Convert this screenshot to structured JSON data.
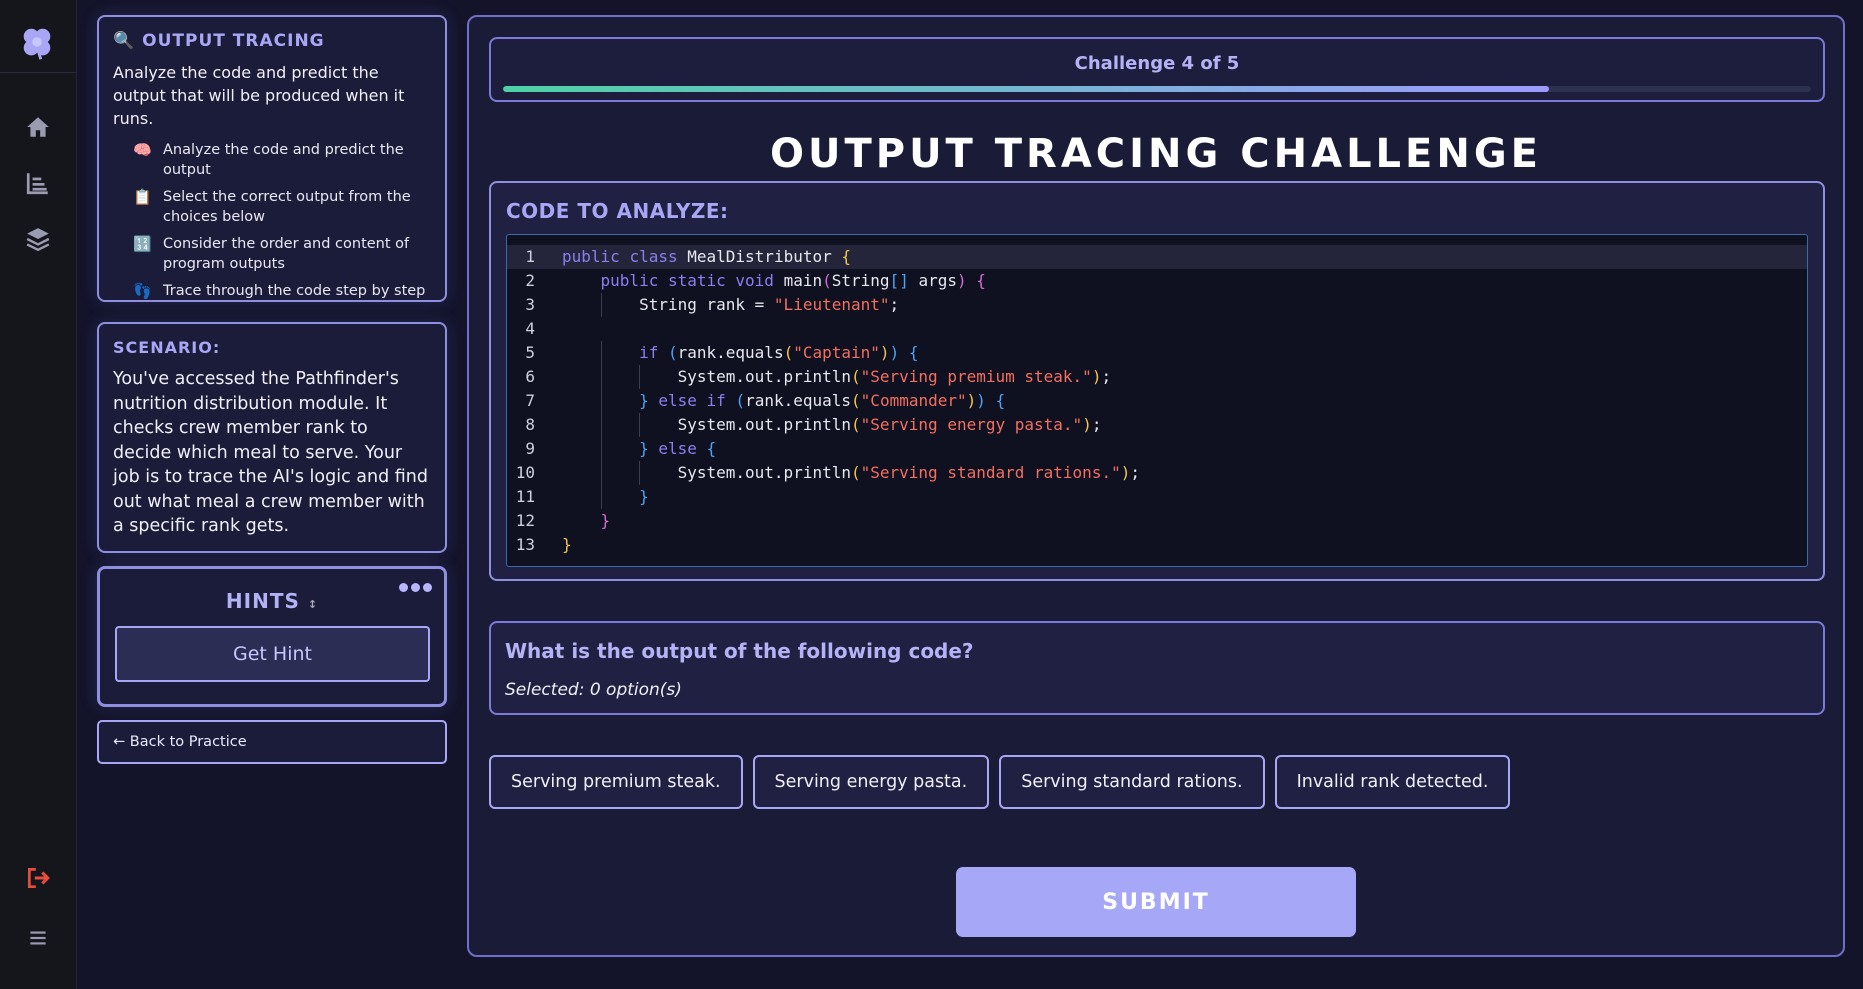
{
  "colors": {
    "accent": "#a9a7f5",
    "progress_start": "#4fd1a5",
    "progress_end": "#9d9bff",
    "logout": "#e74c3c",
    "submit": "#a7a7f8"
  },
  "rail": {
    "icons": [
      "clover-logo-icon",
      "home-icon",
      "chart-icon",
      "layers-icon",
      "logout-icon",
      "menu-icon"
    ]
  },
  "instructions": {
    "title": "OUTPUT TRACING",
    "icon": "🔍",
    "description": "Analyze the code and predict the output that will be produced when it runs.",
    "items": [
      {
        "emoji": "🧠",
        "text": "Analyze the code and predict the output"
      },
      {
        "emoji": "📋",
        "text": "Select the correct output from the choices below"
      },
      {
        "emoji": "🔢",
        "text": "Consider the order and content of program outputs"
      },
      {
        "emoji": "👣",
        "text": "Trace through the code step by step"
      }
    ]
  },
  "scenario": {
    "title": "SCENARIO:",
    "body": "You've accessed the Pathfinder's nutrition distribution module. It checks crew member rank to decide which meal to serve. Your job is to trace the AI's logic and find out what meal a crew member with a specific rank gets."
  },
  "hints": {
    "title": "HINTS",
    "arrow": "↕",
    "button": "Get Hint"
  },
  "back_label": "← Back to Practice",
  "progress": {
    "label": "Challenge 4 of 5",
    "fraction": 0.8
  },
  "main_title": "OUTPUT TRACING CHALLENGE",
  "code_title": "CODE TO ANALYZE:",
  "code_lines": [
    "public class MealDistributor {",
    "    public static void main(String[] args) {",
    "        String rank = \"Lieutenant\";",
    "",
    "        if (rank.equals(\"Captain\")) {",
    "            System.out.println(\"Serving premium steak.\");",
    "        } else if (rank.equals(\"Commander\")) {",
    "            System.out.println(\"Serving energy pasta.\");",
    "        } else {",
    "            System.out.println(\"Serving standard rations.\");",
    "        }",
    "    }",
    "}"
  ],
  "question": {
    "text": "What is the output of the following code?",
    "selected": "Selected: 0 option(s)"
  },
  "options": [
    "Serving premium steak.",
    "Serving energy pasta.",
    "Serving standard rations.",
    "Invalid rank detected."
  ],
  "submit_label": "SUBMIT"
}
